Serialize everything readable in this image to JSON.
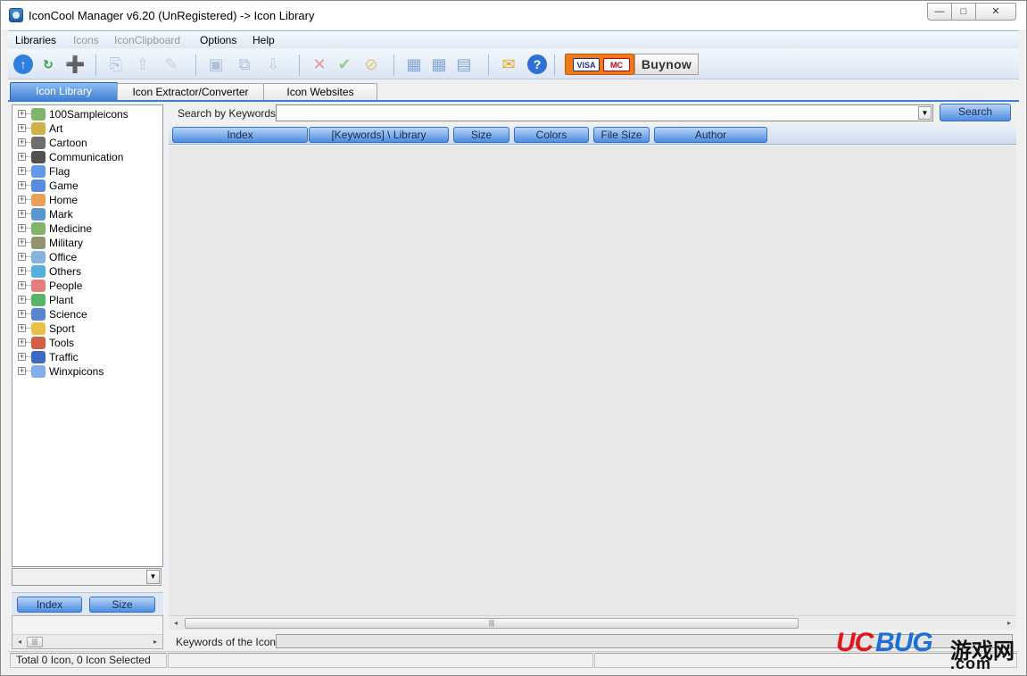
{
  "window": {
    "title": "IconCool Manager v6.20 (UnRegistered) -> Icon Library",
    "controls": {
      "minimize": "—",
      "maximize": "□",
      "close": "✕"
    }
  },
  "menu": {
    "items": [
      {
        "label": "Libraries",
        "enabled": true
      },
      {
        "label": "Icons",
        "enabled": false
      },
      {
        "label": "IconClipboard",
        "enabled": false
      },
      {
        "label": "Options",
        "enabled": true
      },
      {
        "label": "Help",
        "enabled": true
      }
    ]
  },
  "toolbar": {
    "buttons": [
      {
        "name": "up-icon",
        "glyph": "↑",
        "color": "#2f7fe0",
        "enabled": true
      },
      {
        "name": "refresh-icon",
        "glyph": "↻",
        "color": "#2ea043",
        "enabled": true
      },
      {
        "name": "new-folder-icon",
        "glyph": "➕",
        "color": "#e6b422",
        "enabled": true
      },
      {
        "name": "copy-icon",
        "glyph": "⎘",
        "color": "#9fb6d6",
        "enabled": false
      },
      {
        "name": "export-icon",
        "glyph": "⇧",
        "color": "#b7c7d9",
        "enabled": false
      },
      {
        "name": "edit-icon",
        "glyph": "✎",
        "color": "#bfc8d6",
        "enabled": false
      },
      {
        "name": "save-icon",
        "glyph": "▣",
        "color": "#9db1d1",
        "enabled": false
      },
      {
        "name": "save-all-icon",
        "glyph": "⧉",
        "color": "#9db1d1",
        "enabled": false
      },
      {
        "name": "import-icon",
        "glyph": "⇩",
        "color": "#b7c7d9",
        "enabled": false
      },
      {
        "name": "delete-icon",
        "glyph": "✕",
        "color": "#e07a7a",
        "enabled": false
      },
      {
        "name": "check-icon",
        "glyph": "✔",
        "color": "#7cc47c",
        "enabled": false
      },
      {
        "name": "cancel-icon",
        "glyph": "⊘",
        "color": "#e2b45a",
        "enabled": false
      },
      {
        "name": "view-large-icon",
        "glyph": "▦",
        "color": "#7fa6d8",
        "enabled": true
      },
      {
        "name": "view-small-icon",
        "glyph": "▦",
        "color": "#7fa6d8",
        "enabled": true
      },
      {
        "name": "view-detail-icon",
        "glyph": "▤",
        "color": "#7fa6d8",
        "enabled": true
      },
      {
        "name": "email-icon",
        "glyph": "✉",
        "color": "#e6a91f",
        "enabled": true
      },
      {
        "name": "help-icon",
        "glyph": "?",
        "color": "#2f6fd8",
        "enabled": true
      }
    ],
    "cards": {
      "visa": "VISA",
      "mastercard": "MC"
    },
    "buynow_label": "Buynow"
  },
  "tabs": [
    {
      "label": "Icon Library",
      "active": true
    },
    {
      "label": "Icon Extractor/Converter",
      "active": false
    },
    {
      "label": "Icon Websites",
      "active": false
    }
  ],
  "tree": {
    "items": [
      {
        "label": "100Sampleicons",
        "icon": "stack-icon",
        "color": "#6aa84f"
      },
      {
        "label": "Art",
        "icon": "art-icon",
        "color": "#c9a227"
      },
      {
        "label": "Cartoon",
        "icon": "cartoon-icon",
        "color": "#555555"
      },
      {
        "label": "Communication",
        "icon": "phone-icon",
        "color": "#333333"
      },
      {
        "label": "Flag",
        "icon": "flag-icon",
        "color": "#4a86e8"
      },
      {
        "label": "Game",
        "icon": "game-icon",
        "color": "#3c78d8"
      },
      {
        "label": "Home",
        "icon": "home-icon",
        "color": "#e69138"
      },
      {
        "label": "Mark",
        "icon": "mark-icon",
        "color": "#3d85c6"
      },
      {
        "label": "Medicine",
        "icon": "medicine-icon",
        "color": "#6aa84f"
      },
      {
        "label": "Military",
        "icon": "military-icon",
        "color": "#7f7f55"
      },
      {
        "label": "Office",
        "icon": "office-icon",
        "color": "#6fa8dc"
      },
      {
        "label": "Others",
        "icon": "globe-icon",
        "color": "#38a0d8"
      },
      {
        "label": "People",
        "icon": "people-icon",
        "color": "#e06666"
      },
      {
        "label": "Plant",
        "icon": "plant-icon",
        "color": "#38a849"
      },
      {
        "label": "Science",
        "icon": "science-icon",
        "color": "#3d6fc6"
      },
      {
        "label": "Sport",
        "icon": "sport-icon",
        "color": "#e6b422"
      },
      {
        "label": "Tools",
        "icon": "tools-icon",
        "color": "#cc4125"
      },
      {
        "label": "Traffic",
        "icon": "car-icon",
        "color": "#1c4fb8"
      },
      {
        "label": "Winxpicons",
        "icon": "winxp-icon",
        "color": "#6d9eeb"
      }
    ],
    "expander": "+"
  },
  "left_sort": {
    "index_label": "Index",
    "size_label": "Size"
  },
  "search": {
    "label": "Search by Keywords",
    "value": "",
    "button": "Search"
  },
  "columns": [
    {
      "label": "Index"
    },
    {
      "label": "[Keywords] \\ Library"
    },
    {
      "label": "Size"
    },
    {
      "label": "Colors"
    },
    {
      "label": "File Size"
    },
    {
      "label": "Author"
    }
  ],
  "scroll": {
    "thumb_glyph": "|||",
    "left": "◂",
    "right": "▸"
  },
  "keywords": {
    "label": "Keywords of the Icon"
  },
  "status": {
    "text": "Total 0 Icon, 0 Icon Selected"
  },
  "watermark": {
    "part1": "UC",
    "part2": "BUG",
    "cn": "游戏网",
    "com": ".com"
  },
  "dropdown_glyph": "▼"
}
